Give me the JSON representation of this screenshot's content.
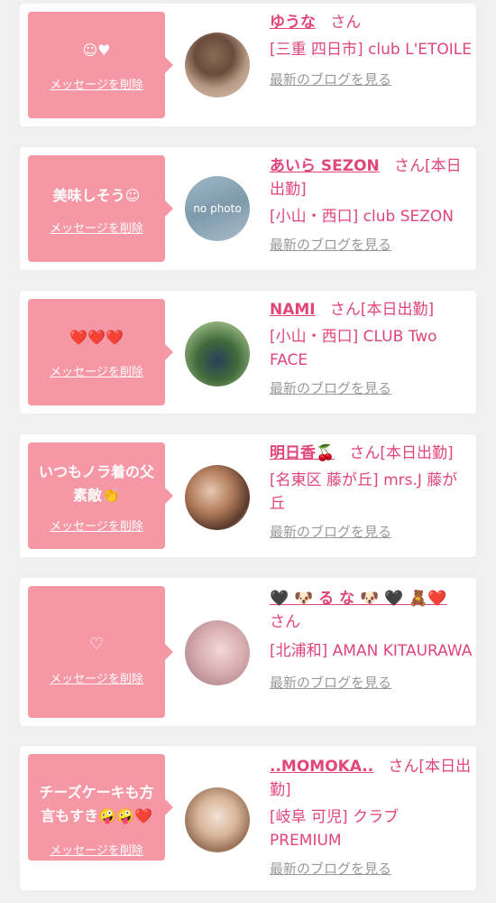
{
  "cards": [
    {
      "message": "☺♥",
      "delete_label": "メッセージを削除",
      "name": "ゆうな",
      "san_text": "さん",
      "shop": "[三重 四日市] club L'ETOILE",
      "blog_label": "最新のブログを見る"
    },
    {
      "message": "美味しそう☺",
      "delete_label": "メッセージを削除",
      "name": "あいら SEZON",
      "san_text": "さん[本日出勤]",
      "shop": "[小山・西口] club SEZON",
      "blog_label": "最新のブログを見る",
      "avatar_text": "no photo"
    },
    {
      "message": "❤️❤️❤️",
      "delete_label": "メッセージを削除",
      "name": "NAMI",
      "san_text": "さん[本日出勤]",
      "shop": "[小山・西口] CLUB Two FACE",
      "blog_label": "最新のブログを見る"
    },
    {
      "message": "いつもノラ着の父素敵👏",
      "delete_label": "メッセージを削除",
      "name": "明日香🍒",
      "san_text": "さん[本日出勤]",
      "shop": "[名東区 藤が丘] mrs.J 藤が丘",
      "blog_label": "最新のブログを見る"
    },
    {
      "message": "♡",
      "delete_label": "メッセージを削除",
      "name": "🖤 🐶 る な 🐶 🖤 🧸❤️",
      "san_text": "さん",
      "shop": "[北浦和] AMAN KITAURAWA",
      "blog_label": "最新のブログを見る"
    },
    {
      "message": "チーズケーキも方言もすき🤪🤪❤️",
      "delete_label": "メッセージを削除",
      "name": "..MOMOKA..",
      "san_text": "さん[本日出勤]",
      "shop": "[岐阜 可児] クラブ PREMIUM",
      "blog_label": "最新のブログを見る"
    }
  ],
  "colors": {
    "bubble": "#f597a4",
    "accent": "#e0457b",
    "muted": "#999999",
    "background": "#f0f0f0"
  }
}
